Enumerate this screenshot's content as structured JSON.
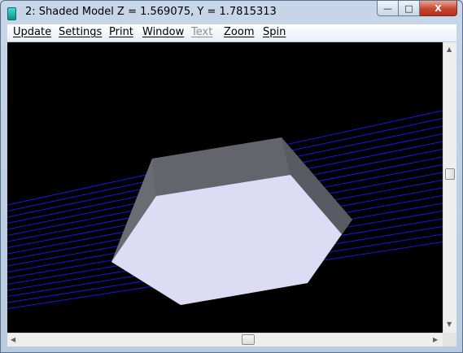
{
  "window": {
    "title": "2: Shaded Model Z = 1.569075, Y = 1.7815313"
  },
  "caption_buttons": {
    "minimize": "—",
    "maximize": "□",
    "close": "X"
  },
  "menubar": {
    "items": [
      {
        "label": "Update",
        "enabled": true
      },
      {
        "label": "Settings",
        "enabled": true
      },
      {
        "label": "Print",
        "enabled": true
      },
      {
        "label": "Window",
        "enabled": true
      },
      {
        "label": "Text",
        "enabled": false
      },
      {
        "label": "Zoom",
        "enabled": true
      },
      {
        "label": "Spin",
        "enabled": true
      }
    ]
  },
  "viewport": {
    "background": "#000000",
    "ray_color": "#1818e0",
    "face_top_color": "#dcdcf4",
    "face_side_color": "#5c5c64"
  }
}
